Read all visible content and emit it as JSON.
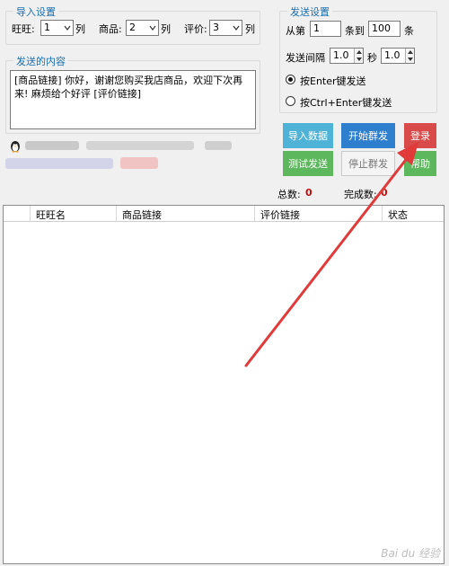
{
  "import_settings": {
    "title": "导入设置",
    "wangwang_label": "旺旺:",
    "wangwang_value": "1",
    "goods_label": "商品:",
    "goods_value": "2",
    "review_label": "评价:",
    "review_value": "3",
    "column_unit": "列"
  },
  "send_content": {
    "title": "发送的内容",
    "text": "[商品链接] 你好，谢谢您购买我店商品，欢迎下次再来! 麻烦给个好评 [评价链接]"
  },
  "send_settings": {
    "title": "发送设置",
    "from_label": "从第",
    "from_value": "1",
    "to_label": "条到",
    "to_value": "100",
    "count_unit": "条",
    "interval_label": "发送间隔",
    "interval_min": "1.0",
    "seconds_label": "秒",
    "interval_max": "1.0",
    "radio_enter": "按Enter键发送",
    "radio_ctrl_enter": "按Ctrl+Enter键发送"
  },
  "buttons": {
    "import_data": "导入数据",
    "start_send": "开始群发",
    "login": "登录",
    "test_send": "测试发送",
    "stop_send": "停止群发",
    "help": "帮助"
  },
  "stats": {
    "total_label": "总数:",
    "total_value": "0",
    "done_label": "完成数:",
    "done_value": "0"
  },
  "table": {
    "columns": [
      "旺旺名",
      "商品链接",
      "评价链接",
      "状态"
    ]
  },
  "colors": {
    "title_blue": "#1a6fb0",
    "btn_cyan": "#4fb3d8",
    "btn_blue": "#2f7fcf",
    "btn_red": "#d94a4a",
    "btn_green": "#5db85d",
    "arrow_red": "#e03a3a"
  },
  "watermark": "Bai du 经验"
}
